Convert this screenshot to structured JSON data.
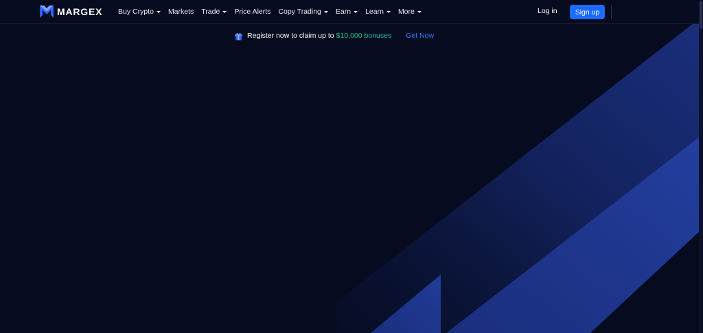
{
  "brand": {
    "name": "MARGEX",
    "accent_color": "#1a6cff",
    "background_color": "#060b1f",
    "highlight_color": "#19c39a"
  },
  "nav": {
    "items": [
      {
        "label": "Buy Crypto",
        "has_dropdown": true
      },
      {
        "label": "Markets",
        "has_dropdown": false
      },
      {
        "label": "Trade",
        "has_dropdown": true
      },
      {
        "label": "Price Alerts",
        "has_dropdown": false
      },
      {
        "label": "Copy Trading",
        "has_dropdown": true
      },
      {
        "label": "Earn",
        "has_dropdown": true
      },
      {
        "label": "Learn",
        "has_dropdown": true
      },
      {
        "label": "More",
        "has_dropdown": true
      }
    ]
  },
  "auth": {
    "login_label": "Log in",
    "signup_label": "Sign up"
  },
  "promo": {
    "icon": "gift-icon",
    "text": "Register now to claim up to",
    "amount": "$10,000 bonuses",
    "cta": "Get Now"
  }
}
